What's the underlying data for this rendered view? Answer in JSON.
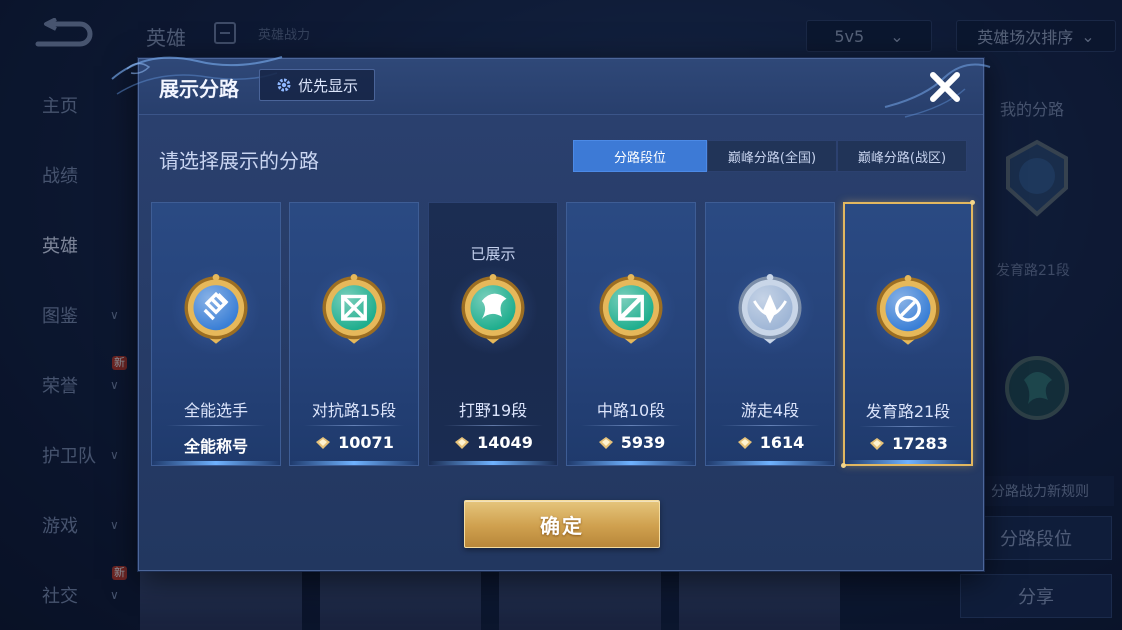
{
  "background": {
    "header_title": "英雄",
    "header_subtitle": "英雄战力",
    "mode_select": "5v5",
    "sort_select": "英雄场次排序",
    "side_menu": [
      {
        "label": "主页",
        "has_arrow": false,
        "new": false
      },
      {
        "label": "战绩",
        "has_arrow": false,
        "new": false
      },
      {
        "label": "英雄",
        "has_arrow": false,
        "new": false,
        "active": true
      },
      {
        "label": "图鉴",
        "has_arrow": true,
        "new": false
      },
      {
        "label": "荣誉",
        "has_arrow": true,
        "new": true
      },
      {
        "label": "护卫队",
        "has_arrow": true,
        "new": false
      },
      {
        "label": "游戏",
        "has_arrow": true,
        "new": false
      },
      {
        "label": "社交",
        "has_arrow": true,
        "new": true
      }
    ],
    "new_badge": "新",
    "right_panel": {
      "label": "我的分路",
      "lane_text": "发育路21段",
      "rule_text": "分路战力新规则",
      "button_lane_rank": "分路段位",
      "button_share": "分享"
    }
  },
  "modal": {
    "title": "展示分路",
    "priority_button": "优先显示",
    "prompt": "请选择展示的分路",
    "tabs": [
      {
        "label": "分路段位",
        "active": true
      },
      {
        "label": "巅峰分路(全国)",
        "active": false
      },
      {
        "label": "巅峰分路(战区)",
        "active": false
      }
    ],
    "cards": [
      {
        "name": "全能选手",
        "score": "全能称号",
        "icon": "all-round-emblem-icon",
        "color": "#3a7fd6",
        "shown": "",
        "dark": false,
        "selected": false,
        "has_fist": false
      },
      {
        "name": "对抗路15段",
        "score": "10071",
        "icon": "clash-lane-emblem-icon",
        "color": "#1fae8e",
        "shown": "",
        "dark": false,
        "selected": false,
        "has_fist": true
      },
      {
        "name": "打野19段",
        "score": "14049",
        "icon": "jungle-emblem-icon",
        "color": "#1fae8e",
        "shown": "已展示",
        "dark": true,
        "selected": false,
        "has_fist": true
      },
      {
        "name": "中路10段",
        "score": "5939",
        "icon": "mid-lane-emblem-icon",
        "color": "#1fae8e",
        "shown": "",
        "dark": false,
        "selected": false,
        "has_fist": true
      },
      {
        "name": "游走4段",
        "score": "1614",
        "icon": "roam-emblem-icon",
        "color": "#9fb6d6",
        "shown": "",
        "dark": false,
        "selected": false,
        "has_fist": true
      },
      {
        "name": "发育路21段",
        "score": "17283",
        "icon": "farm-lane-emblem-icon",
        "color": "#3a7fd6",
        "shown": "",
        "dark": false,
        "selected": true,
        "has_fist": true
      }
    ],
    "confirm_button": "确定"
  }
}
